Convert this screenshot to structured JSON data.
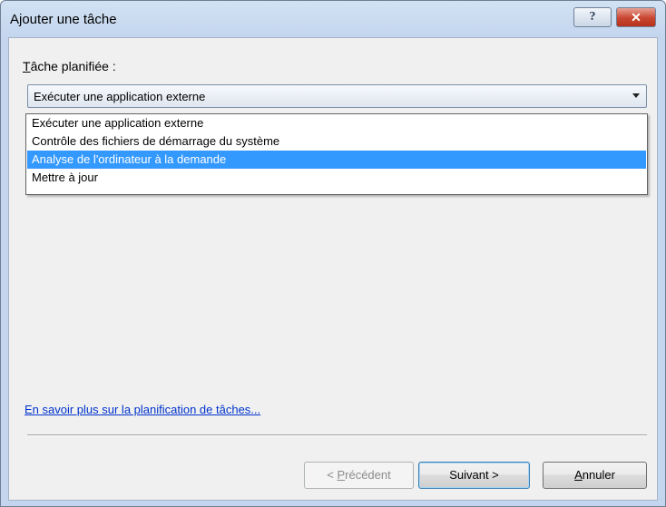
{
  "window": {
    "title": "Ajouter une tâche",
    "help_label": "?",
    "close_label": "✕"
  },
  "task_label": "Tâche planifiée :",
  "combo": {
    "selected_value": "Exécuter une application externe"
  },
  "options": [
    "Exécuter une application externe",
    "Contrôle des fichiers de démarrage du système",
    "Analyse de l'ordinateur à la demande",
    "Mettre à jour"
  ],
  "highlighted_option_index": 2,
  "link_text": "En savoir plus sur la planification de tâches...",
  "buttons": {
    "previous": "< Précédent",
    "next": "Suivant >",
    "cancel": "Annuler"
  }
}
